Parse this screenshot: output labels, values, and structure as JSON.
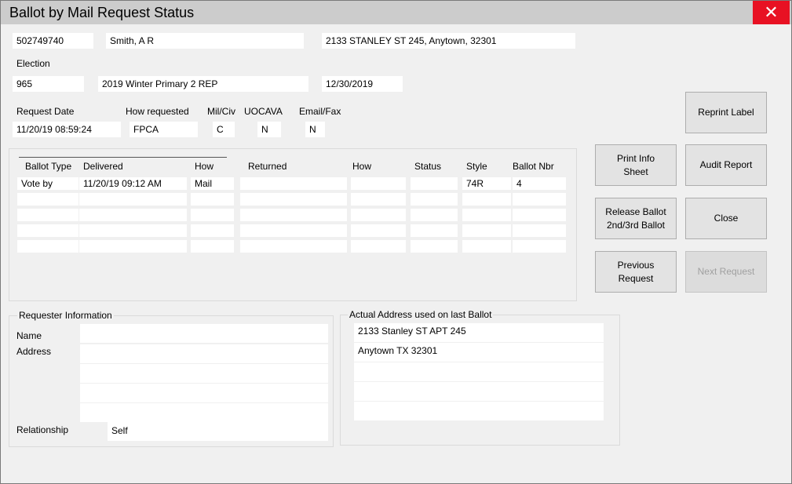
{
  "window": {
    "title": "Ballot by Mail Request Status",
    "close_glyph": "✕"
  },
  "voter": {
    "id": "502749740",
    "name": "Smith, A R",
    "address": "2133 STANLEY ST 245, Anytown, 32301"
  },
  "election": {
    "label": "Election",
    "number": "965",
    "name": "2019 Winter Primary 2 REP",
    "date": "12/30/2019"
  },
  "request": {
    "date_label": "Request Date",
    "how_label": "How requested",
    "milciv_label": "Mil/Civ",
    "uocava_label": "UOCAVA",
    "emailfax_label": "Email/Fax",
    "date": "11/20/19 08:59:24",
    "how": "FPCA",
    "milciv": "C",
    "uocava": "N",
    "emailfax": "N"
  },
  "ballot_table": {
    "columns": [
      "Ballot Type",
      "Delivered",
      "How",
      "Returned",
      "How",
      "Status",
      "Style",
      "Ballot Nbr"
    ],
    "rows": [
      [
        "Vote by",
        "11/20/19 09:12 AM",
        "Mail",
        "",
        "",
        "",
        "74R",
        "4"
      ],
      [
        "",
        "",
        "",
        "",
        "",
        "",
        "",
        ""
      ],
      [
        "",
        "",
        "",
        "",
        "",
        "",
        "",
        ""
      ],
      [
        "",
        "",
        "",
        "",
        "",
        "",
        "",
        ""
      ],
      [
        "",
        "",
        "",
        "",
        "",
        "",
        "",
        ""
      ]
    ]
  },
  "buttons": {
    "reprint_label": "Reprint Label",
    "print_info_1": "Print Info",
    "print_info_2": "Sheet",
    "audit_report": "Audit Report",
    "release_1": "Release Ballot",
    "release_2": "2nd/3rd Ballot",
    "close": "Close",
    "previous_1": "Previous",
    "previous_2": "Request",
    "next_request": "Next Request"
  },
  "requester": {
    "group_title": "Requester Information",
    "name_label": "Name",
    "address_label": "Address",
    "relationship_label": "Relationship",
    "name": "",
    "address_lines": [
      "",
      "",
      "",
      ""
    ],
    "relationship": "Self"
  },
  "actual_address": {
    "group_title": "Actual Address used on last Ballot",
    "lines": [
      "2133 Stanley ST APT 245",
      "Anytown TX 32301",
      "",
      "",
      ""
    ]
  },
  "colors": {
    "close_button": "#e81123",
    "title_bar": "#cccccc",
    "window_bg": "#f0f0f0"
  }
}
